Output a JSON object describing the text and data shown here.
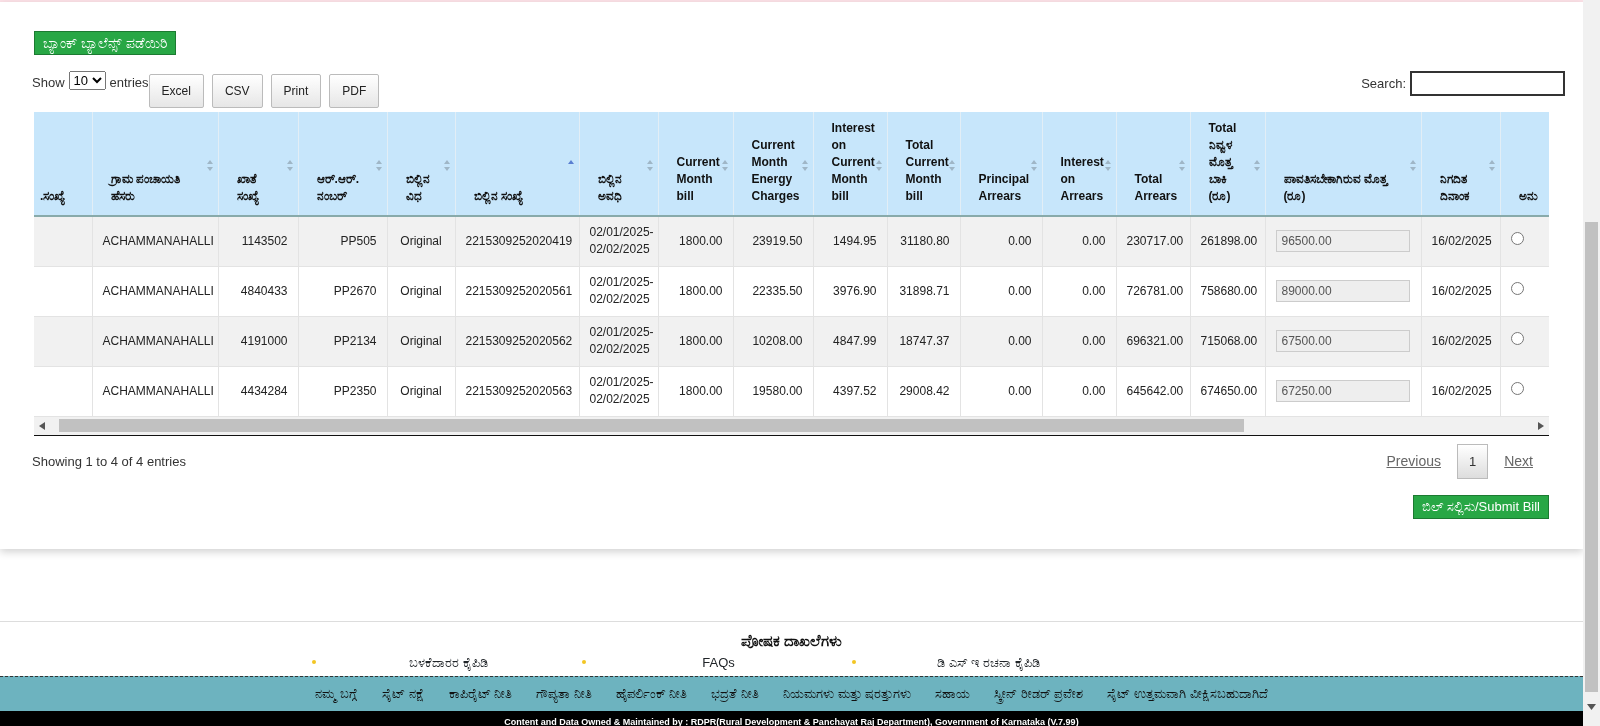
{
  "top_button": "ಬ್ಯಾಂಕ್ ಬ್ಯಾಲೆನ್ಸ್ ಪಡೆಯಿರಿ",
  "length_menu": {
    "prefix": "Show",
    "value": "10",
    "suffix": "entries"
  },
  "export_buttons": [
    "Excel",
    "CSV",
    "Print",
    "PDF"
  ],
  "search": {
    "label": "Search:"
  },
  "table": {
    "columns": [
      {
        "label": ".ಸಂಖ್ಯೆ",
        "sortable": false,
        "sorted_ascending": false
      },
      {
        "label": "ಗ್ರಾಮ ಪಂಚಾಯತಿ ಹೆಸರು",
        "sortable": true,
        "sorted_ascending": false
      },
      {
        "label": "ಖಾತೆ ಸಂಖ್ಯೆ",
        "sortable": true,
        "sorted_ascending": false
      },
      {
        "label": "ಆರ್.ಆರ್. ನಂಬರ್",
        "sortable": true,
        "sorted_ascending": false
      },
      {
        "label": "ಬಿಲ್ಲಿನ ವಿಧ",
        "sortable": true,
        "sorted_ascending": false
      },
      {
        "label": "ಬಿಲ್ಲಿನ ಸಂಖ್ಯೆ",
        "sortable": true,
        "sorted_ascending": true
      },
      {
        "label": "ಬಿಲ್ಲಿನ ಅವಧಿ",
        "sortable": true,
        "sorted_ascending": false
      },
      {
        "label": "Current Month bill",
        "sortable": true,
        "sorted_ascending": false
      },
      {
        "label": "Current Month Energy Charges",
        "sortable": true,
        "sorted_ascending": false
      },
      {
        "label": "Interest on Current Month bill",
        "sortable": true,
        "sorted_ascending": false
      },
      {
        "label": "Total Current Month bill",
        "sortable": true,
        "sorted_ascending": false
      },
      {
        "label": "Principal Arrears",
        "sortable": true,
        "sorted_ascending": false
      },
      {
        "label": "Interest on Arrears",
        "sortable": true,
        "sorted_ascending": false
      },
      {
        "label": "Total Arrears",
        "sortable": true,
        "sorted_ascending": false
      },
      {
        "label": "Total ನಿವ್ವಳ ಮೊತ್ತ ಬಾಕಿ (ರೂ)",
        "sortable": true,
        "sorted_ascending": false
      },
      {
        "label": "ಪಾವತಿಸಬೇಕಾಗಿರುವ ಮೊತ್ತ (ರೂ)",
        "sortable": true,
        "sorted_ascending": false
      },
      {
        "label": "ನಿಗದಿತ ದಿನಾಂಕ",
        "sortable": true,
        "sorted_ascending": false
      },
      {
        "label": "ಅನು",
        "sortable": false,
        "sorted_ascending": false
      }
    ],
    "rows": [
      {
        "cells": [
          "",
          "ACHAMMANAHALLI",
          "1143502",
          "PP505",
          "Original",
          "2215309252020419",
          "02/01/2025-02/02/2025",
          "1800.00",
          "23919.50",
          "1494.95",
          "31180.80",
          "0.00",
          "0.00",
          "230717.00",
          "261898.00"
        ],
        "amount": "96500.00",
        "due_date": "16/02/2025",
        "selected": false
      },
      {
        "cells": [
          "",
          "ACHAMMANAHALLI",
          "4840433",
          "PP2670",
          "Original",
          "2215309252020561",
          "02/01/2025-02/02/2025",
          "1800.00",
          "22335.50",
          "3976.90",
          "31898.71",
          "0.00",
          "0.00",
          "726781.00",
          "758680.00"
        ],
        "amount": "89000.00",
        "due_date": "16/02/2025",
        "selected": false
      },
      {
        "cells": [
          "",
          "ACHAMMANAHALLI",
          "4191000",
          "PP2134",
          "Original",
          "2215309252020562",
          "02/01/2025-02/02/2025",
          "1800.00",
          "10208.00",
          "4847.99",
          "18747.37",
          "0.00",
          "0.00",
          "696321.00",
          "715068.00"
        ],
        "amount": "67500.00",
        "due_date": "16/02/2025",
        "selected": false
      },
      {
        "cells": [
          "",
          "ACHAMMANAHALLI",
          "4434284",
          "PP2350",
          "Original",
          "2215309252020563",
          "02/01/2025-02/02/2025",
          "1800.00",
          "19580.00",
          "4397.52",
          "29008.42",
          "0.00",
          "0.00",
          "645642.00",
          "674650.00"
        ],
        "amount": "67250.00",
        "due_date": "16/02/2025",
        "selected": false
      }
    ]
  },
  "info": "Showing 1 to 4 of 4 entries",
  "pagination": {
    "previous": "Previous",
    "pages": [
      {
        "label": "1",
        "selected": true
      }
    ],
    "next": "Next"
  },
  "submit_button": "ಬಿಲ್ ಸಲ್ಲಿಸು/Submit Bill",
  "footer": {
    "heading": "ಪೋಷಕ ದಾಖಲೆಗಳು",
    "links": [
      "ಬಳಕೆದಾರರ ಕೈಪಿಡಿ",
      "FAQs",
      "ಡಿ ಎಸ್ ಇ ರಚನಾ ಕೈಪಿಡಿ"
    ],
    "nav": [
      "ನಮ್ಮ ಬಗ್ಗೆ",
      "ಸೈಟ್ ನಕ್ಷೆ",
      "ಕಾಪಿರೈಟ್ ನೀತಿ",
      "ಗೌಪ್ಯತಾ ನೀತಿ",
      "ಹೈಪರ್ಲಿಂಕ್ ನೀತಿ",
      "ಭದ್ರತೆ ನೀತಿ",
      "ನಿಯಮಗಳು ಮತ್ತು ಷರತ್ತುಗಳು",
      "ಸಹಾಯ",
      "ಸ್ಕ್ರೀನ್ ರೀಡರ್ ಪ್ರವೇಶ",
      "ಸೈಟ್ ಉತ್ತಮವಾಗಿ ವೀಕ್ಷಿಸಬಹುದಾಗಿದೆ"
    ],
    "copyright": "Content and Data Owned & Maintained by : RDPR(Rural Development & Panchayat Raj Department), Government of Karnataka (V.7.99)"
  }
}
